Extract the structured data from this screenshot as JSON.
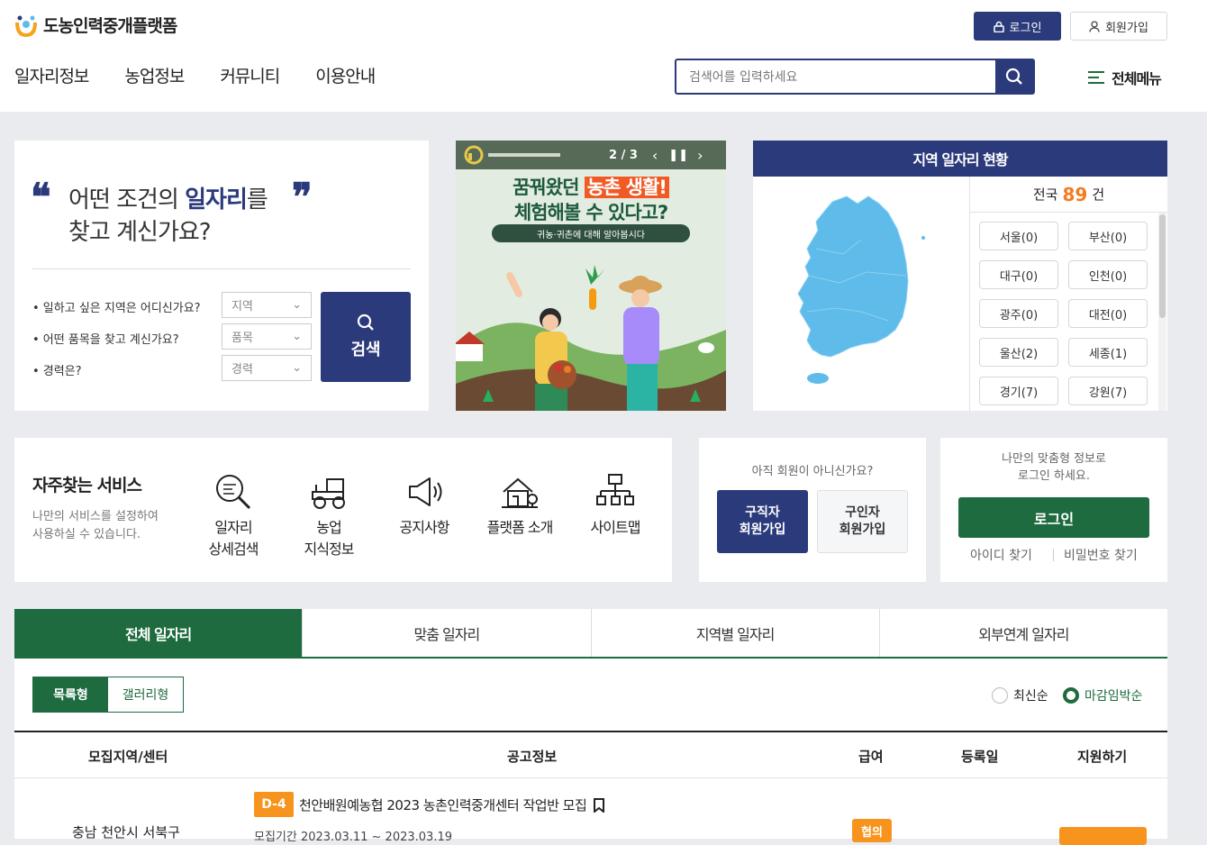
{
  "header": {
    "logo_text": "도농인력중개플랫폼",
    "login_label": "로그인",
    "join_label": "회원가입",
    "nav": [
      "일자리정보",
      "농업정보",
      "커뮤니티",
      "이용안내"
    ],
    "search_placeholder": "검색어를 입력하세요",
    "all_menu_label": "전체메뉴"
  },
  "finder": {
    "title_line1_pre": "어떤 조건의 ",
    "title_line1_em": "일자리",
    "title_line1_post": "를",
    "title_line2": "찾고 계신가요?",
    "conditions": [
      {
        "label": "• 일하고 싶은 지역은 어디신가요?",
        "select": "지역"
      },
      {
        "label": "• 어떤 품목을 찾고 계신가요?",
        "select": "품목"
      },
      {
        "label": "• 경력은?",
        "select": "경력"
      }
    ],
    "search_button": "검색"
  },
  "banner": {
    "page": "2 / 3",
    "headline_pre": "꿈꿔왔던 ",
    "headline_highlight": "농촌 생활!",
    "headline_line2": "체험해볼 수 있다고?",
    "pill": "귀농·귀촌에 대해 알아봅시다"
  },
  "region": {
    "title": "지역 일자리 현황",
    "total_label": "전국",
    "total_count": "89",
    "total_unit": "건",
    "items": [
      "서울(0)",
      "부산(0)",
      "대구(0)",
      "인천(0)",
      "광주(0)",
      "대전(0)",
      "울산(2)",
      "세종(1)",
      "경기(7)",
      "강원(7)"
    ]
  },
  "services": {
    "title": "자주찾는 서비스",
    "desc_line1": "나만의 서비스를 설정하여",
    "desc_line2": "사용하실 수 있습니다.",
    "items": [
      {
        "line1": "일자리",
        "line2": "상세검색",
        "icon": "magnifier-doc-icon"
      },
      {
        "line1": "농업",
        "line2": "지식정보",
        "icon": "tractor-icon"
      },
      {
        "line1": "공지사항",
        "line2": "",
        "icon": "megaphone-icon"
      },
      {
        "line1": "플랫폼 소개",
        "line2": "",
        "icon": "farmhouse-icon"
      },
      {
        "line1": "사이트맵",
        "line2": "",
        "icon": "sitemap-icon"
      }
    ]
  },
  "join": {
    "question": "아직 회원이 아니신가요?",
    "seeker_line1": "구직자",
    "seeker_line2": "회원가입",
    "employer_line1": "구인자",
    "employer_line2": "회원가입"
  },
  "login": {
    "line1": "나만의 맞춤형 정보로",
    "line2": "로그인 하세요.",
    "button": "로그인",
    "find_id": "아이디 찾기",
    "find_pw": "비밀번호 찾기"
  },
  "tabs": [
    "전체 일자리",
    "맞춤 일자리",
    "지역별 일자리",
    "외부연계 일자리"
  ],
  "list": {
    "view_list": "목록형",
    "view_gallery": "갤러리형",
    "sort_newest": "최신순",
    "sort_deadline": "마감임박순",
    "columns": [
      "모집지역/센터",
      "공고정보",
      "급여",
      "등록일",
      "지원하기"
    ],
    "first_row": {
      "dday": "D-4",
      "title": "천안배원예농협 2023 농촌인력중개센터 작업반 모집",
      "region": "충남 천안시 서북구",
      "period": "모집기간  2023.03.11 ~ 2023.03.19",
      "pay": "협의"
    }
  },
  "colors": {
    "navy": "#2b3a7a",
    "green": "#1d6b3e",
    "orange": "#f47b20",
    "map_blue": "#5ebbea"
  }
}
